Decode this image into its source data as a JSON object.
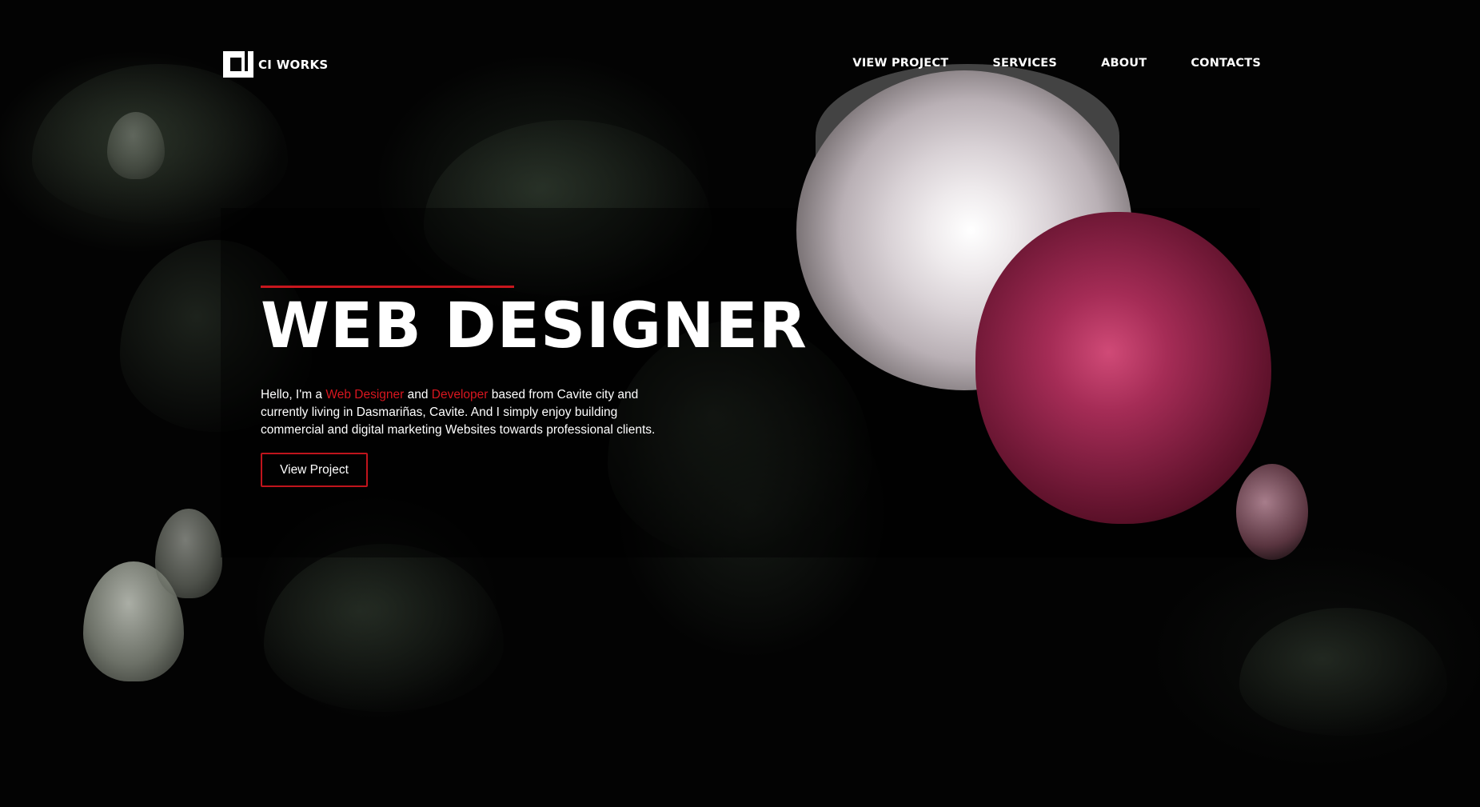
{
  "brand": {
    "name": "CI WORKS",
    "logo_icon": "ci-works-logo-icon"
  },
  "nav": {
    "items": [
      {
        "label": "VIEW PROJECT"
      },
      {
        "label": "SERVICES"
      },
      {
        "label": "ABOUT"
      },
      {
        "label": "CONTACTS"
      }
    ]
  },
  "hero": {
    "title": "WEB DESIGNER",
    "intro": {
      "part1": "Hello, I'm a ",
      "highlight1": "Web Designer",
      "part2": " and ",
      "highlight2": "Developer",
      "part3": " based from Cavite city and currently living in Dasmariñas, Cavite. And I simply enjoy building commercial and digital marketing Websites towards professional clients."
    },
    "cta_label": "View Project"
  },
  "colors": {
    "accent": "#c8161d",
    "background": "#030303",
    "text": "#ffffff"
  }
}
